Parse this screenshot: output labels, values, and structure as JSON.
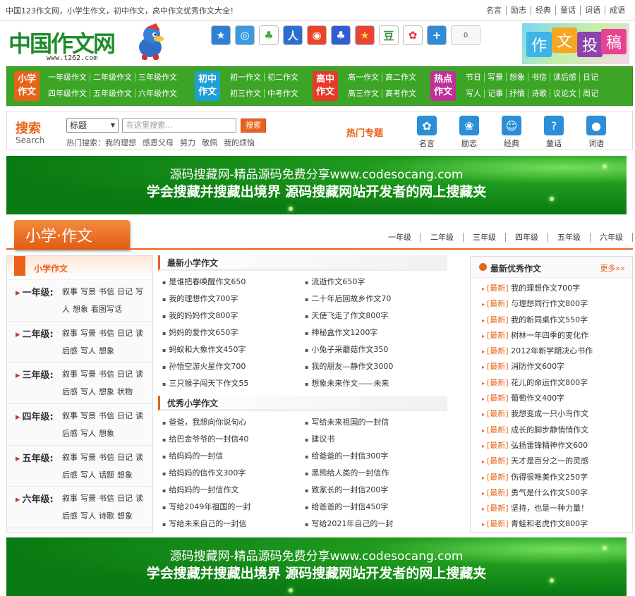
{
  "top": {
    "tagline": "中国123作文网，小学生作文，初中作文，高中作文优秀作文大全！",
    "links": [
      "名言",
      "励志",
      "经典",
      "童话",
      "词语",
      "成语"
    ]
  },
  "logo": {
    "title": "中国作文网",
    "url": "www.t262.com"
  },
  "share": {
    "count": "0"
  },
  "tougao": [
    "作",
    "文",
    "投",
    "稿"
  ],
  "nav": {
    "xiaoxue": {
      "tag1": "小学",
      "tag2": "作文",
      "row1": [
        "一年级作文",
        "二年级作文",
        "三年级作文"
      ],
      "row2": [
        "四年级作文",
        "五年级作文",
        "六年级作文"
      ]
    },
    "chuzhong": {
      "tag1": "初中",
      "tag2": "作文",
      "row1": [
        "初一作文",
        "初二作文"
      ],
      "row2": [
        "初三作文",
        "中考作文"
      ]
    },
    "gaozhong": {
      "tag1": "高中",
      "tag2": "作文",
      "row1": [
        "高一作文",
        "高二作文"
      ],
      "row2": [
        "高三作文",
        "高考作文"
      ]
    },
    "redian": {
      "tag1": "热点",
      "tag2": "作文",
      "row1": [
        "节日",
        "写景",
        "想象",
        "书信",
        "读后感",
        "日记"
      ],
      "row2": [
        "写人",
        "记事",
        "抒情",
        "诗歌",
        "议论文",
        "周记"
      ]
    }
  },
  "search": {
    "title": "搜索",
    "sub": "Search",
    "select": "标题",
    "placeholder": "在这里搜索...",
    "button": "搜索",
    "hot_label": "热门搜索：",
    "hot_keywords": [
      "我的理想",
      "感恩父母",
      "努力",
      "敬佩",
      "我的烦恼"
    ],
    "topics_title": "热门专题",
    "topics": [
      "名言",
      "励志",
      "经典",
      "童话",
      "词语"
    ]
  },
  "banner": {
    "line1": "源码搜藏网-精品源码免费分享www.codesocang.com",
    "line2": "学会搜藏并搜藏出境界 源码搜藏网站开发者的网上搜藏夹"
  },
  "section": {
    "title": "小学·作文",
    "grades": [
      "一年级",
      "二年级",
      "三年级",
      "四年级",
      "五年级",
      "六年级"
    ]
  },
  "left": {
    "title": "小学作文",
    "grades": [
      {
        "name": "一年级:",
        "links": [
          "叙事",
          "写景",
          "书信",
          "日记",
          "写人",
          "想象",
          "看图写话"
        ]
      },
      {
        "name": "二年级:",
        "links": [
          "叙事",
          "写景",
          "书信",
          "日记",
          "读后感",
          "写人",
          "想象"
        ]
      },
      {
        "name": "三年级:",
        "links": [
          "叙事",
          "写景",
          "书信",
          "日记",
          "读后感",
          "写人",
          "想象",
          "状物"
        ]
      },
      {
        "name": "四年级:",
        "links": [
          "叙事",
          "写景",
          "书信",
          "日记",
          "读后感",
          "写人",
          "想象"
        ]
      },
      {
        "name": "五年级:",
        "links": [
          "叙事",
          "写景",
          "书信",
          "日记",
          "读后感",
          "写人",
          "话题",
          "想象"
        ]
      },
      {
        "name": "六年级:",
        "links": [
          "叙事",
          "写景",
          "书信",
          "日记",
          "读后感",
          "写人",
          "诗歌",
          "想象"
        ]
      }
    ]
  },
  "middle": {
    "latest_title": "最新小学作文",
    "latest": [
      "是谁把春唤醒作文650",
      "流逝作文650字",
      "我的理想作文700字",
      "二十年后回故乡作文70",
      "我的妈妈作文800字",
      "天使飞走了作文800字",
      "妈妈的爱作文650字",
      "神秘盒作文1200字",
      "蚂蚁和大象作文450字",
      "小兔子采蘑菇作文350",
      "孙悟空游火星作文700",
      "我的朋友—静作文3000",
      "三只猴子闯天下作文55",
      "想象未来作文——未来"
    ],
    "excellent_title": "优秀小学作文",
    "excellent": [
      "爸爸，我想向你说句心",
      "写给未来祖国的一封信",
      "给巴金爷爷的一封信40",
      "建议书",
      "给妈妈的一封信",
      "给爸爸的一封信300字",
      "给妈妈的信作文300字",
      "黑熊给人类的一封信作",
      "给妈妈的一封信作文",
      "致家长的一封信200字",
      "写给2049年祖国的一封",
      "给爸爸的一封信450字",
      "写给未来自己的一封信",
      "写给2021年自己的一封"
    ]
  },
  "right": {
    "title": "最新优秀作文",
    "more": "更多»»",
    "tag": "[最新]",
    "items": [
      "我的理想作文700字",
      "与理想同行作文800字",
      "我的新同桌作文550字",
      "树林一年四季的变化作",
      "2012年新学期决心书作",
      "消防作文600字",
      "花儿的命运作文800字",
      "葡萄作文400字",
      "我想变成一只小鸟作文",
      "成长的脚步静悄悄作文",
      "弘扬雷锋精神作文600",
      "天才是百分之一的灵感",
      "伤得很唯美作文250字",
      "勇气是什么作文500字",
      "坚持，也是一种力量！",
      "青蛙和老虎作文800字"
    ]
  },
  "colors": {
    "green": "#3ca526",
    "orange": "#e8621a"
  }
}
